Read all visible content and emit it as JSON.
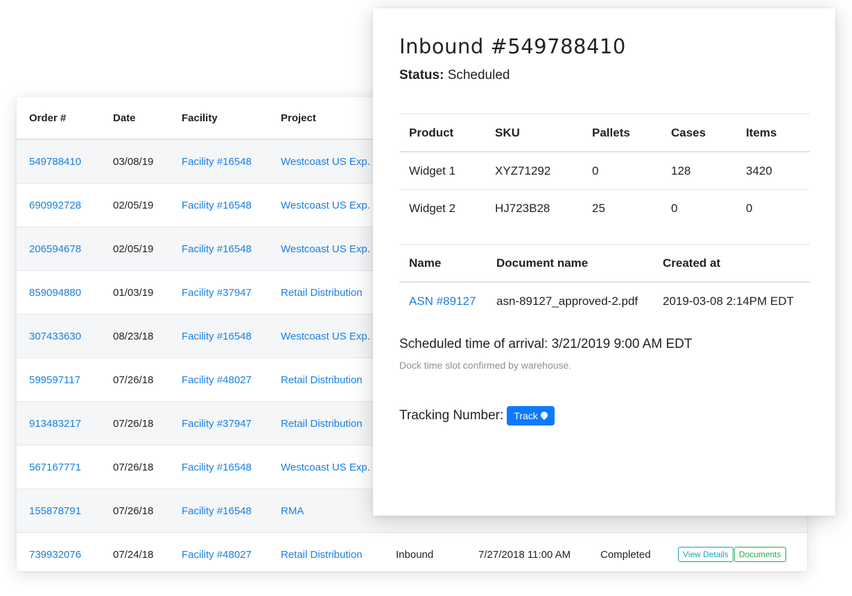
{
  "orders": {
    "columns": [
      "Order #",
      "Date",
      "Facility",
      "Project"
    ],
    "rows": [
      {
        "order": "549788410",
        "date": "03/08/19",
        "facility": "Facility #16548",
        "project": "Westcoast US Exp."
      },
      {
        "order": "690992728",
        "date": "02/05/19",
        "facility": "Facility #16548",
        "project": "Westcoast US Exp."
      },
      {
        "order": "206594678",
        "date": "02/05/19",
        "facility": "Facility #16548",
        "project": "Westcoast US Exp."
      },
      {
        "order": "859094880",
        "date": "01/03/19",
        "facility": "Facility #37947",
        "project": "Retail Distribution"
      },
      {
        "order": "307433630",
        "date": "08/23/18",
        "facility": "Facility #16548",
        "project": "Westcoast US Exp."
      },
      {
        "order": "599597117",
        "date": "07/26/18",
        "facility": "Facility #48027",
        "project": "Retail Distribution"
      },
      {
        "order": "913483217",
        "date": "07/26/18",
        "facility": "Facility #37947",
        "project": "Retail Distribution"
      },
      {
        "order": "567167771",
        "date": "07/26/18",
        "facility": "Facility #16548",
        "project": "Westcoast US Exp."
      },
      {
        "order": "155878791",
        "date": "07/26/18",
        "facility": "Facility #16548",
        "project": "RMA"
      },
      {
        "order": "739932076",
        "date": "07/24/18",
        "facility": "Facility #48027",
        "project": "Retail Distribution",
        "type": "Inbound",
        "eta": "7/27/2018 11:00 AM",
        "status": "Completed",
        "details_label": "View Details",
        "docs_label": "Documents"
      }
    ]
  },
  "modal": {
    "title": "Inbound #549788410",
    "status_label": "Status:",
    "status_value": "Scheduled",
    "products": {
      "columns": [
        "Product",
        "SKU",
        "Pallets",
        "Cases",
        "Items"
      ],
      "rows": [
        [
          "Widget 1",
          "XYZ71292",
          "0",
          "128",
          "3420"
        ],
        [
          "Widget 2",
          "HJ723B28",
          "25",
          "0",
          "0"
        ]
      ]
    },
    "documents": {
      "columns": [
        "Name",
        "Document name",
        "Created at"
      ],
      "rows": [
        {
          "name": "ASN #89127",
          "document": "asn-89127_approved-2.pdf",
          "created": "2019-03-08 2:14PM EDT"
        }
      ]
    },
    "arrival": "Scheduled time of arrival: 3/21/2019 9:00 AM EDT",
    "arrival_note": "Dock time slot confirmed by warehouse.",
    "tracking_label": "Tracking Number:",
    "track_button": "Track"
  },
  "colors": {
    "link": "#1a7fe0",
    "track_button": "#0b7bff",
    "view_details": "#17a2b8",
    "documents": "#28a745"
  },
  "icons": [
    "map-pin-icon"
  ]
}
